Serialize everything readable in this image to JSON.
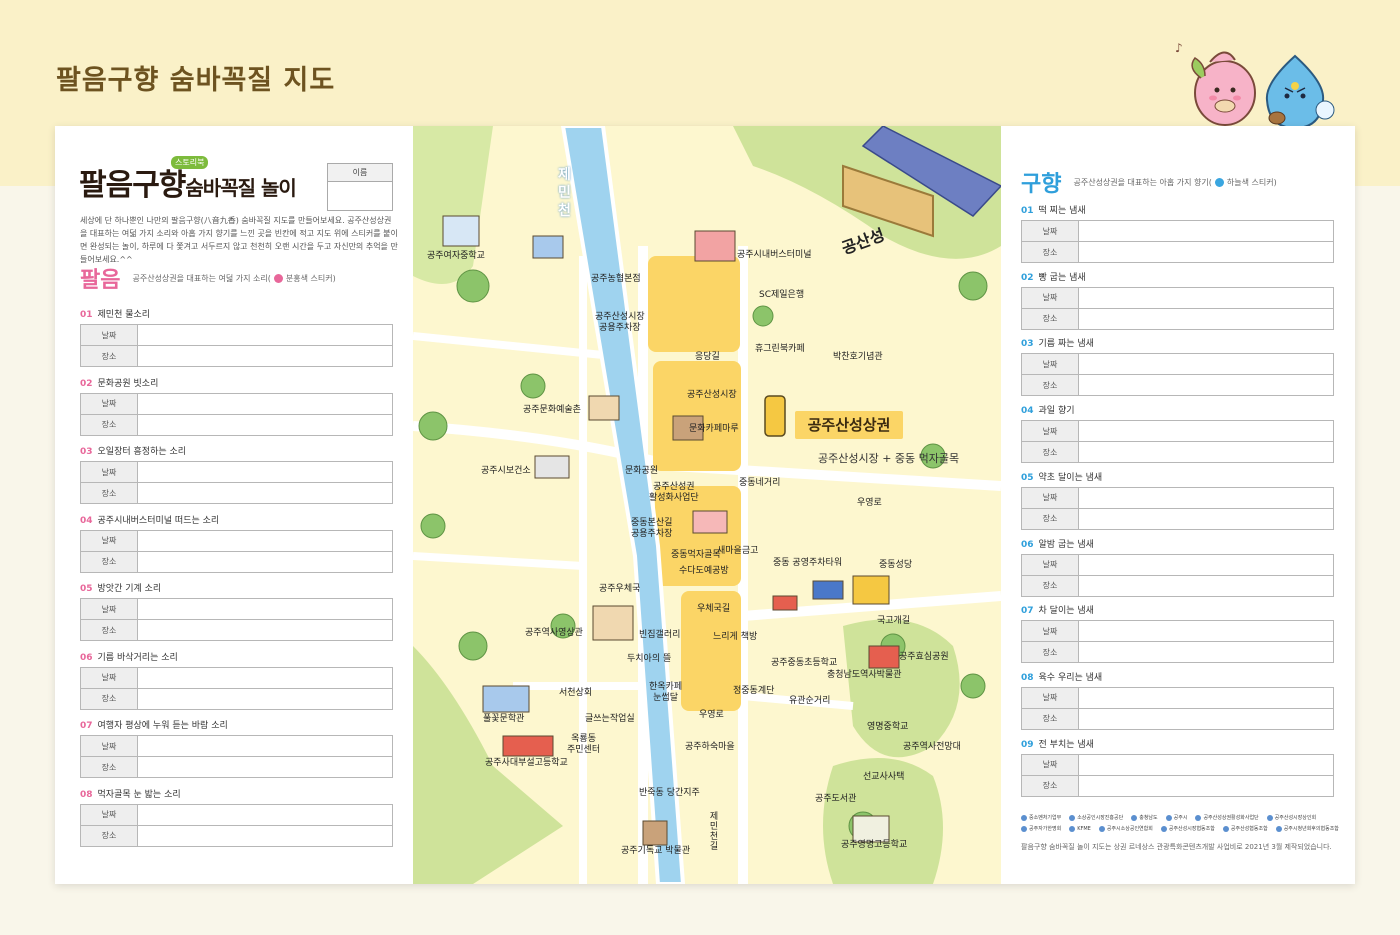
{
  "page_title": "팔음구향 숨바꼭질 지도",
  "left": {
    "logo_main": "팔음구향",
    "logo_sub": "숨바꼭질 놀이",
    "logo_badge": "스토리북",
    "name_label": "이름",
    "intro": "세상에 단 하나뿐인 나만의 팔음구향(八音九香) 숨바꼭질 지도를 만들어보세요. 공주산성상권을 대표하는 여덟 가지 소리와 아홉 가지 향기를 느낀 곳을 빈칸에 적고 지도 위에 스티커를 붙이면 완성되는 놀이, 하루에 다 쫓겨고 서두르지 않고 천천히 오랜 시간을 두고 자신만의 추억을 만들어보세요.^^",
    "section_title": "팔음",
    "section_desc_before": "공주산성상권을 대표하는 여덟 가지 소리(",
    "section_desc_after": "분홍색 스티커)",
    "dot_color": "#e8679a",
    "date_label": "날짜",
    "place_label": "장소",
    "items": [
      {
        "num": "01",
        "title": "제민천 물소리"
      },
      {
        "num": "02",
        "title": "문화공원 빗소리"
      },
      {
        "num": "03",
        "title": "오일장터 흥정하는 소리"
      },
      {
        "num": "04",
        "title": "공주시내버스터미널 떠드는 소리"
      },
      {
        "num": "05",
        "title": "방앗간 기계 소리"
      },
      {
        "num": "06",
        "title": "기름 바삭거리는 소리"
      },
      {
        "num": "07",
        "title": "여행자 평상에 누워 듣는 바람 소리"
      },
      {
        "num": "08",
        "title": "먹자골목 눈 밟는 소리"
      }
    ]
  },
  "right": {
    "section_title": "구향",
    "section_desc_before": "공주산성상권을 대표하는 아홉 가지 향기(",
    "section_desc_after": "하늘색 스티커)",
    "dot_color": "#3aa6e0",
    "date_label": "날짜",
    "place_label": "장소",
    "items": [
      {
        "num": "01",
        "title": "떡 찌는 냄새"
      },
      {
        "num": "02",
        "title": "빵 굽는 냄새"
      },
      {
        "num": "03",
        "title": "기름 짜는 냄새"
      },
      {
        "num": "04",
        "title": "과일 향기"
      },
      {
        "num": "05",
        "title": "약초 달이는 냄새"
      },
      {
        "num": "06",
        "title": "알밤 굽는 냄새"
      },
      {
        "num": "07",
        "title": "차 달이는 냄새"
      },
      {
        "num": "08",
        "title": "육수 우리는 냄새"
      },
      {
        "num": "09",
        "title": "전 부치는 냄새"
      }
    ],
    "logos": [
      "중소벤처기업부",
      "소상공인시장진흥공단",
      "충청남도",
      "공주시",
      "공주산성상권활성화사업단",
      "공주산성시장상인회",
      "공주자가한명회",
      "KFME",
      "공주시소상공인연합회",
      "공주산성시장협동조합",
      "공주산성협동조합",
      "공주시청년회후의협동조합"
    ],
    "footnote": "팔음구향 숨바꼭질 놀이 지도는 상권 르네상스 관광특화콘텐츠개발 사업비로 2021년 3월 제작되었습니다."
  },
  "map": {
    "area_title": "공주산성상권",
    "area_subtitle": "공주산성시장 + 중동 먹자골목",
    "river_name": "제민천",
    "labels": [
      {
        "id": "gongsanseong",
        "text": "공산성"
      },
      {
        "id": "girls-middle",
        "text": "공주여자중학교"
      },
      {
        "id": "nonghyup",
        "text": "공주농협본점"
      },
      {
        "id": "bus-terminal",
        "text": "공주시내버스터미널"
      },
      {
        "id": "sc-bank",
        "text": "SC제일은행"
      },
      {
        "id": "market-parking",
        "text": "공주산성시장\n공용주차장"
      },
      {
        "id": "eungdanggil",
        "text": "응당길"
      },
      {
        "id": "cafe-hugo",
        "text": "휴그린북카페"
      },
      {
        "id": "bakchan-museum",
        "text": "박찬호기념관"
      },
      {
        "id": "art-village",
        "text": "공주문화예술촌"
      },
      {
        "id": "sanseong-market",
        "text": "공주산성시장"
      },
      {
        "id": "culture-cafe",
        "text": "문화카페마루"
      },
      {
        "id": "health-center",
        "text": "공주시보건소"
      },
      {
        "id": "culture-park",
        "text": "문화공원"
      },
      {
        "id": "revival-center",
        "text": "공주산성권\n활성화사업단"
      },
      {
        "id": "jungdong-crossroad",
        "text": "중동네거리"
      },
      {
        "id": "uyeongno",
        "text": "우영로"
      },
      {
        "id": "bonsan-parking",
        "text": "중동본산길\n공용주차장"
      },
      {
        "id": "food-alley",
        "text": "중동먹자골목"
      },
      {
        "id": "saemaeul",
        "text": "새마을금고"
      },
      {
        "id": "sudado",
        "text": "수다도예공방"
      },
      {
        "id": "jungdong-parking",
        "text": "중동 공영주차타워"
      },
      {
        "id": "jungdong-church",
        "text": "중동성당"
      },
      {
        "id": "post-office",
        "text": "공주우체국"
      },
      {
        "id": "postgil",
        "text": "우체국길"
      },
      {
        "id": "history-cinema",
        "text": "공주역사영상관"
      },
      {
        "id": "binjip-gallery",
        "text": "빈집갤러리"
      },
      {
        "id": "slow-bookstore",
        "text": "느리게 책방"
      },
      {
        "id": "dochiya",
        "text": "두치아의 뜰"
      },
      {
        "id": "gukgogaegil",
        "text": "국고개길"
      },
      {
        "id": "hyosim-park",
        "text": "공주효심공원"
      },
      {
        "id": "jungdong-elementary",
        "text": "공주중동초등학교"
      },
      {
        "id": "chungnam-museum",
        "text": "충청남도역사박물관"
      },
      {
        "id": "seocheon-hall",
        "text": "서천상회"
      },
      {
        "id": "hanok-cafe",
        "text": "한옥카페\n눈썹달"
      },
      {
        "id": "jungdong-stair",
        "text": "정중동계단"
      },
      {
        "id": "yugwan-crossroad",
        "text": "유관순거리"
      },
      {
        "id": "yeongmyeong-middle",
        "text": "영명중학교"
      },
      {
        "id": "pulkkot-school",
        "text": "풀꽃문학관"
      },
      {
        "id": "writer-house",
        "text": "글쓰는작업실"
      },
      {
        "id": "uyeongno2",
        "text": "우영로"
      },
      {
        "id": "history-tower",
        "text": "공주역사전망대"
      },
      {
        "id": "ok-community",
        "text": "옥룡동\n주민센터"
      },
      {
        "id": "gongju-haseuk",
        "text": "공주하숙마을"
      },
      {
        "id": "daebu-elementary",
        "text": "공주사대부설고등학교"
      },
      {
        "id": "seongyosa",
        "text": "선교사사택"
      },
      {
        "id": "banjuk-store",
        "text": "반죽동 당간지주"
      },
      {
        "id": "library",
        "text": "공주도서관"
      },
      {
        "id": "jemin-street",
        "text": "제민천길"
      },
      {
        "id": "christian-museum",
        "text": "공주기독교 박물관"
      },
      {
        "id": "yeongmyeong-high",
        "text": "공주영명고등학교"
      }
    ]
  }
}
